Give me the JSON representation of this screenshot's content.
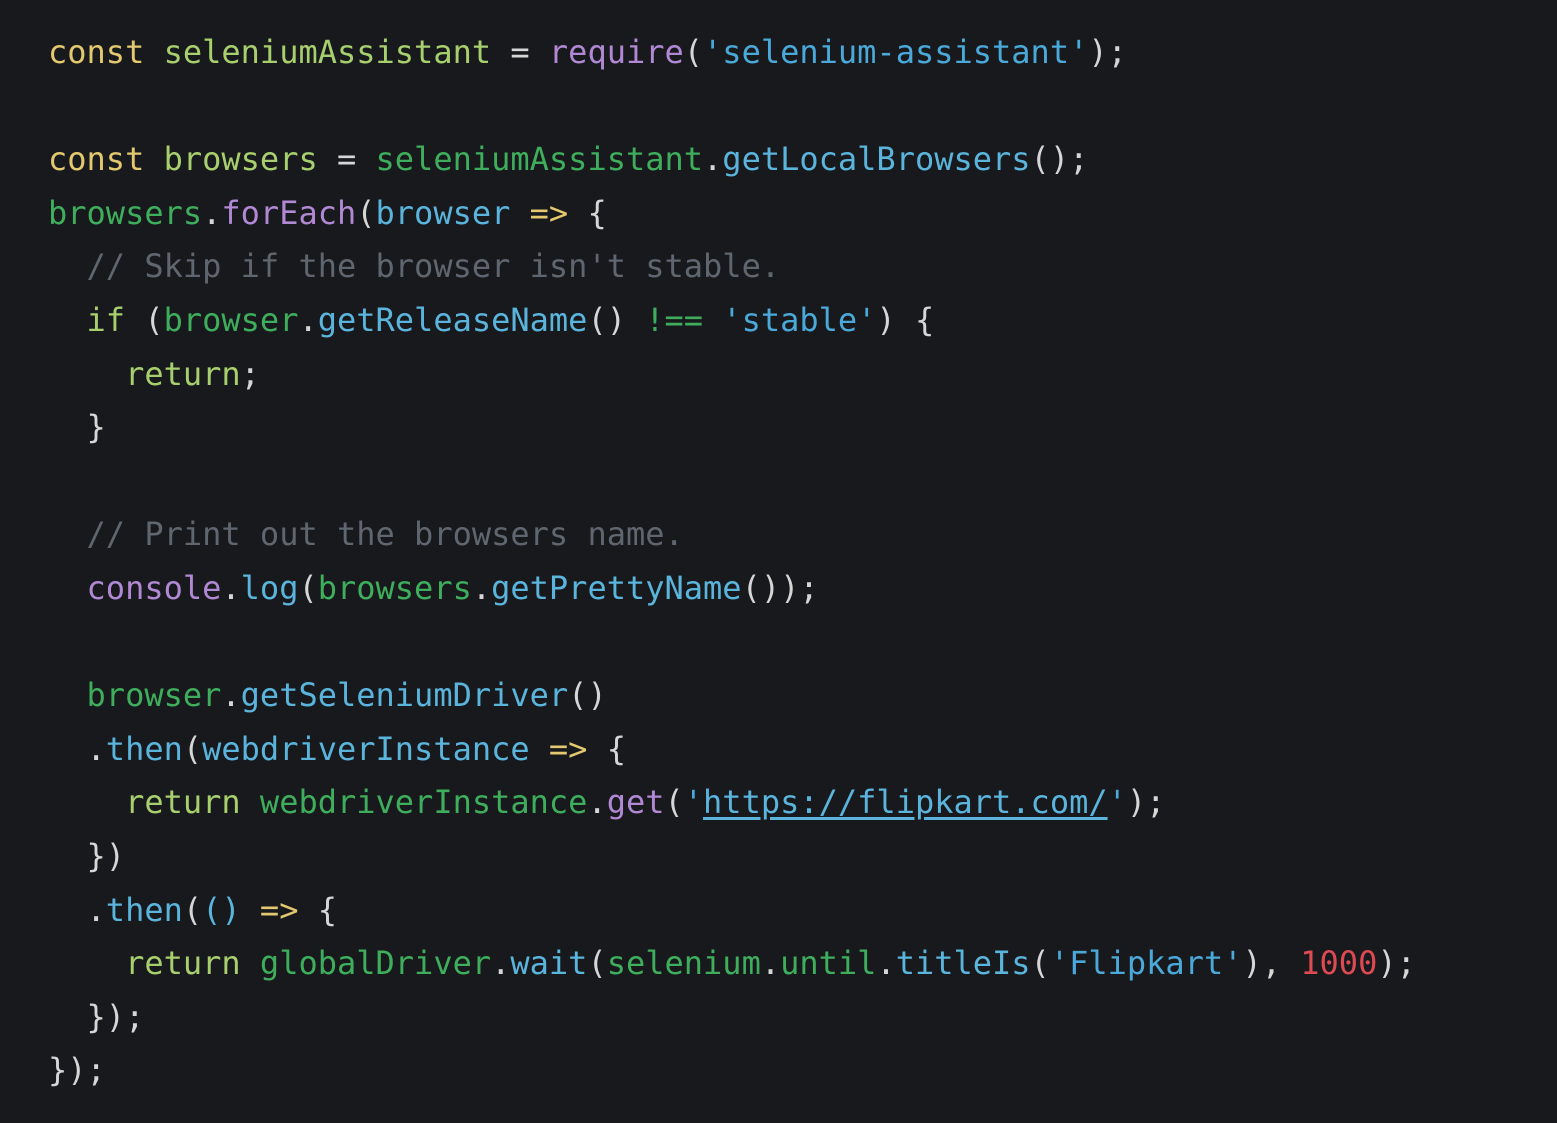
{
  "theme": {
    "background": "#17191c",
    "keyword": "#e3c86f",
    "variable": "#a8cf6e",
    "identifier": "#3fae5c",
    "function": "#5ab4dc",
    "builtin": "#b188d4",
    "string": "#4ba9da",
    "comment": "#5f6670",
    "number": "#de4a52",
    "punctuation": "#d6d6d6",
    "link": "#5ab4dc"
  },
  "code": {
    "lines": [
      {
        "tokens": [
          {
            "text": "const ",
            "role": "keyword"
          },
          {
            "text": "seleniumAssistant",
            "role": "variable"
          },
          {
            "text": " = ",
            "role": "punctuation"
          },
          {
            "text": "require",
            "role": "builtin"
          },
          {
            "text": "(",
            "role": "punctuation"
          },
          {
            "text": "'selenium-assistant'",
            "role": "string"
          },
          {
            "text": ");",
            "role": "punctuation"
          }
        ]
      },
      {
        "tokens": []
      },
      {
        "tokens": [
          {
            "text": "const ",
            "role": "keyword"
          },
          {
            "text": "browsers",
            "role": "variable"
          },
          {
            "text": " = ",
            "role": "punctuation"
          },
          {
            "text": "seleniumAssistant",
            "role": "identifier"
          },
          {
            "text": ".",
            "role": "punctuation"
          },
          {
            "text": "getLocalBrowsers",
            "role": "function"
          },
          {
            "text": "();",
            "role": "punctuation"
          }
        ]
      },
      {
        "tokens": [
          {
            "text": "browsers",
            "role": "identifier"
          },
          {
            "text": ".",
            "role": "punctuation"
          },
          {
            "text": "forEach",
            "role": "builtin"
          },
          {
            "text": "(",
            "role": "punctuation"
          },
          {
            "text": "browser",
            "role": "function"
          },
          {
            "text": " => ",
            "role": "keyword"
          },
          {
            "text": "{",
            "role": "punctuation"
          }
        ]
      },
      {
        "tokens": [
          {
            "text": "  // Skip if the browser isn't stable.",
            "role": "comment"
          }
        ]
      },
      {
        "tokens": [
          {
            "text": "  ",
            "role": "punctuation"
          },
          {
            "text": "if",
            "role": "variable"
          },
          {
            "text": " (",
            "role": "punctuation"
          },
          {
            "text": "browser",
            "role": "identifier"
          },
          {
            "text": ".",
            "role": "punctuation"
          },
          {
            "text": "getReleaseName",
            "role": "function"
          },
          {
            "text": "() ",
            "role": "punctuation"
          },
          {
            "text": "!==",
            "role": "identifier"
          },
          {
            "text": " ",
            "role": "punctuation"
          },
          {
            "text": "'stable'",
            "role": "string"
          },
          {
            "text": ") {",
            "role": "punctuation"
          }
        ]
      },
      {
        "tokens": [
          {
            "text": "    ",
            "role": "punctuation"
          },
          {
            "text": "return",
            "role": "variable"
          },
          {
            "text": ";",
            "role": "punctuation"
          }
        ]
      },
      {
        "tokens": [
          {
            "text": "  }",
            "role": "punctuation"
          }
        ]
      },
      {
        "tokens": []
      },
      {
        "tokens": [
          {
            "text": "  // Print out the browsers name.",
            "role": "comment"
          }
        ]
      },
      {
        "tokens": [
          {
            "text": "  ",
            "role": "punctuation"
          },
          {
            "text": "console",
            "role": "builtin"
          },
          {
            "text": ".",
            "role": "punctuation"
          },
          {
            "text": "log",
            "role": "function"
          },
          {
            "text": "(",
            "role": "punctuation"
          },
          {
            "text": "browsers",
            "role": "identifier"
          },
          {
            "text": ".",
            "role": "punctuation"
          },
          {
            "text": "getPrettyName",
            "role": "function"
          },
          {
            "text": "());",
            "role": "punctuation"
          }
        ]
      },
      {
        "tokens": []
      },
      {
        "tokens": [
          {
            "text": "  ",
            "role": "punctuation"
          },
          {
            "text": "browser",
            "role": "identifier"
          },
          {
            "text": ".",
            "role": "punctuation"
          },
          {
            "text": "getSeleniumDriver",
            "role": "function"
          },
          {
            "text": "()",
            "role": "punctuation"
          }
        ]
      },
      {
        "tokens": [
          {
            "text": "  .",
            "role": "punctuation"
          },
          {
            "text": "then",
            "role": "function"
          },
          {
            "text": "(",
            "role": "punctuation"
          },
          {
            "text": "webdriverInstance",
            "role": "function"
          },
          {
            "text": " => ",
            "role": "keyword"
          },
          {
            "text": "{",
            "role": "punctuation"
          }
        ]
      },
      {
        "tokens": [
          {
            "text": "    ",
            "role": "punctuation"
          },
          {
            "text": "return",
            "role": "variable"
          },
          {
            "text": " ",
            "role": "punctuation"
          },
          {
            "text": "webdriverInstance",
            "role": "identifier"
          },
          {
            "text": ".",
            "role": "punctuation"
          },
          {
            "text": "get",
            "role": "builtin"
          },
          {
            "text": "(",
            "role": "punctuation"
          },
          {
            "text": "'",
            "role": "string"
          },
          {
            "text": "https://flipkart.com/",
            "role": "link"
          },
          {
            "text": "'",
            "role": "string"
          },
          {
            "text": ");",
            "role": "punctuation"
          }
        ]
      },
      {
        "tokens": [
          {
            "text": "  })",
            "role": "punctuation"
          }
        ]
      },
      {
        "tokens": [
          {
            "text": "  .",
            "role": "punctuation"
          },
          {
            "text": "then",
            "role": "function"
          },
          {
            "text": "(",
            "role": "punctuation"
          },
          {
            "text": "()",
            "role": "function"
          },
          {
            "text": " => ",
            "role": "keyword"
          },
          {
            "text": "{",
            "role": "punctuation"
          }
        ]
      },
      {
        "tokens": [
          {
            "text": "    ",
            "role": "punctuation"
          },
          {
            "text": "return",
            "role": "variable"
          },
          {
            "text": " ",
            "role": "punctuation"
          },
          {
            "text": "globalDriver",
            "role": "identifier"
          },
          {
            "text": ".",
            "role": "punctuation"
          },
          {
            "text": "wait",
            "role": "function"
          },
          {
            "text": "(",
            "role": "punctuation"
          },
          {
            "text": "selenium",
            "role": "identifier"
          },
          {
            "text": ".",
            "role": "punctuation"
          },
          {
            "text": "until",
            "role": "identifier"
          },
          {
            "text": ".",
            "role": "punctuation"
          },
          {
            "text": "titleIs",
            "role": "function"
          },
          {
            "text": "(",
            "role": "punctuation"
          },
          {
            "text": "'Flipkart'",
            "role": "string"
          },
          {
            "text": "), ",
            "role": "punctuation"
          },
          {
            "text": "1000",
            "role": "number"
          },
          {
            "text": ");",
            "role": "punctuation"
          }
        ]
      },
      {
        "tokens": [
          {
            "text": "  });",
            "role": "punctuation"
          }
        ]
      },
      {
        "tokens": [
          {
            "text": "});",
            "role": "punctuation"
          }
        ]
      }
    ]
  }
}
